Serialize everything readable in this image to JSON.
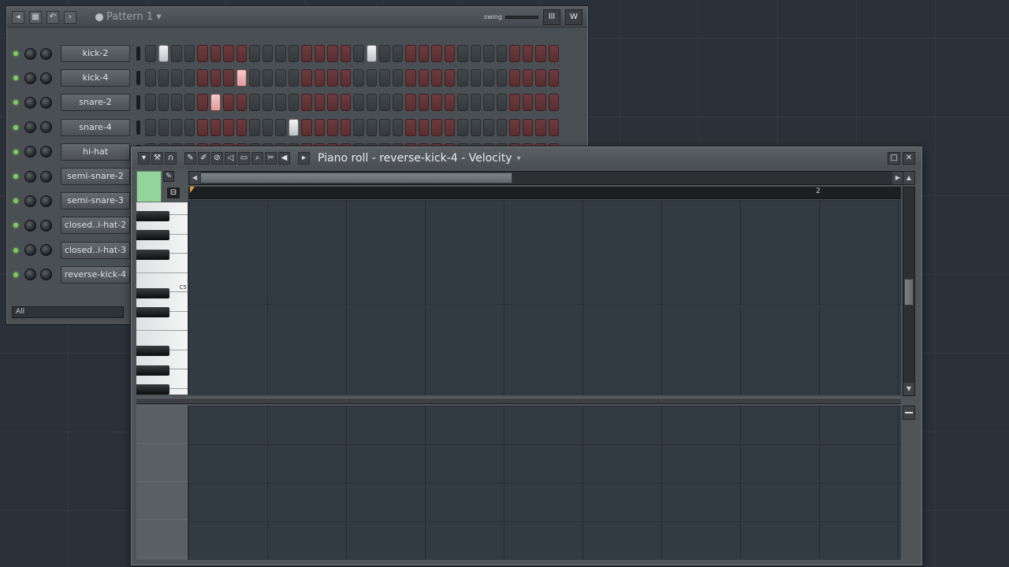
{
  "channel_rack": {
    "pattern_label": "Pattern 1",
    "swing_label": "swing",
    "filter_value": "All",
    "view_buttons": [
      "lll",
      "W"
    ],
    "channels": [
      {
        "name": "kick-2",
        "active": [
          1,
          17
        ]
      },
      {
        "name": "kick-4",
        "active": [
          7
        ]
      },
      {
        "name": "snare-2",
        "active": [
          5
        ]
      },
      {
        "name": "snare-4",
        "active": [
          11
        ]
      },
      {
        "name": "hi-hat",
        "active": []
      },
      {
        "name": "semi-snare-2",
        "active": []
      },
      {
        "name": "semi-snare-3",
        "active": []
      },
      {
        "name": "closed..i-hat-2",
        "active": []
      },
      {
        "name": "closed..i-hat-3",
        "active": []
      },
      {
        "name": "reverse-kick-4",
        "active": []
      }
    ]
  },
  "piano_roll": {
    "title": "Piano roll - reverse-kick-4 - Velocity",
    "bar_marker": "2",
    "key_label": "C5",
    "accent_color": "#93d39c"
  }
}
